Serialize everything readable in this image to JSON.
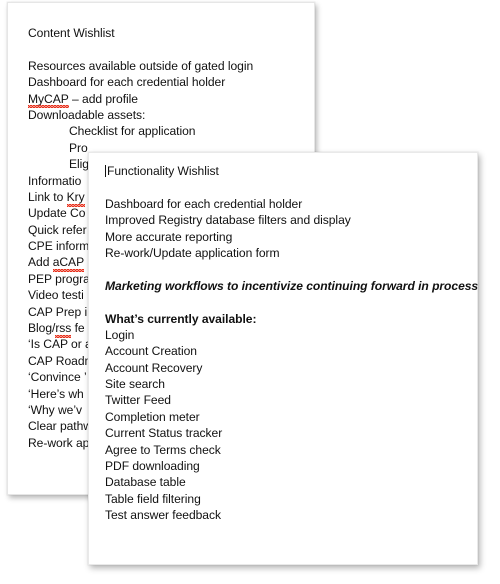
{
  "document": {
    "kind": "slide-deck-thumbnail-overlay",
    "background_color": "#ffffff",
    "text_color": "#111111"
  },
  "slides": [
    {
      "id": "content-wishlist",
      "title": "Content Wishlist",
      "lines": [
        {
          "text": "Content Wishlist",
          "indent": false
        },
        {
          "text": "",
          "indent": false
        },
        {
          "text": "Resources available outside of gated login",
          "indent": false
        },
        {
          "text": "Dashboard for each credential holder",
          "indent": false
        },
        {
          "text": "MyCAP – add profile",
          "indent": false,
          "spellcheck_word": "MyCAP"
        },
        {
          "text": "Downloadable assets:",
          "indent": false
        },
        {
          "text": "Checklist for application",
          "indent": true
        },
        {
          "text": "Pro",
          "indent": true,
          "clipped": true
        },
        {
          "text": "Elig",
          "indent": true,
          "clipped": true
        },
        {
          "text": "Informatio",
          "indent": false,
          "clipped": true
        },
        {
          "text": "Link to Kry",
          "indent": false,
          "clipped": true,
          "spellcheck_word": "Kry"
        },
        {
          "text": "Update Co",
          "indent": false,
          "clipped": true
        },
        {
          "text": "Quick refer",
          "indent": false,
          "clipped": true
        },
        {
          "text": "CPE inform",
          "indent": false,
          "clipped": true
        },
        {
          "text": "Add aCAP ",
          "indent": false,
          "clipped": true,
          "spellcheck_word": "aCAP"
        },
        {
          "text": "PEP progra",
          "indent": false,
          "clipped": true
        },
        {
          "text": "Video testi",
          "indent": false,
          "clipped": true
        },
        {
          "text": "CAP Prep i",
          "indent": false,
          "clipped": true
        },
        {
          "text": "Blog/rss fe",
          "indent": false,
          "clipped": true,
          "spellcheck_word": "rss"
        },
        {
          "text": "‘Is CAP or a",
          "indent": false,
          "clipped": true
        },
        {
          "text": "CAP Roadm",
          "indent": false,
          "clipped": true
        },
        {
          "text": "‘Convince ’",
          "indent": false,
          "clipped": true
        },
        {
          "text": "‘Here’s wh",
          "indent": false,
          "clipped": true
        },
        {
          "text": "‘Why we’v",
          "indent": false,
          "clipped": true
        },
        {
          "text": "Clear pathw",
          "indent": false,
          "clipped": true
        },
        {
          "text": "Re-work ap",
          "indent": false,
          "clipped": true
        }
      ]
    },
    {
      "id": "functionality-wishlist",
      "title": "Functionality Wishlist",
      "lines": [
        {
          "text": "Functionality Wishlist",
          "style": "normal",
          "caret": true
        },
        {
          "text": "",
          "style": "normal"
        },
        {
          "text": "Dashboard for each credential holder",
          "style": "normal"
        },
        {
          "text": "Improved Registry database filters and display",
          "style": "normal"
        },
        {
          "text": "More accurate reporting",
          "style": "normal"
        },
        {
          "text": "Re-work/Update application form",
          "style": "normal"
        },
        {
          "text": "",
          "style": "normal"
        },
        {
          "text": "Marketing workflows to incentivize continuing forward in process",
          "style": "bolditalic"
        },
        {
          "text": "",
          "style": "normal"
        },
        {
          "text": "What’s currently available:",
          "style": "bold"
        },
        {
          "text": "Login",
          "style": "normal"
        },
        {
          "text": "Account Creation",
          "style": "normal"
        },
        {
          "text": "Account Recovery",
          "style": "normal"
        },
        {
          "text": "Site search",
          "style": "normal"
        },
        {
          "text": "Twitter Feed",
          "style": "normal"
        },
        {
          "text": "Completion meter",
          "style": "normal"
        },
        {
          "text": "Current Status tracker",
          "style": "normal"
        },
        {
          "text": "Agree to Terms check",
          "style": "normal"
        },
        {
          "text": "PDF downloading",
          "style": "normal"
        },
        {
          "text": "Database table",
          "style": "normal"
        },
        {
          "text": "Table field filtering",
          "style": "normal"
        },
        {
          "text": "Test answer feedback",
          "style": "normal"
        }
      ]
    }
  ],
  "colors": {
    "text": "#111111",
    "spellcheck_underline": "#e8301c",
    "slide_background": "#ffffff",
    "page_background": "#ffffff"
  }
}
